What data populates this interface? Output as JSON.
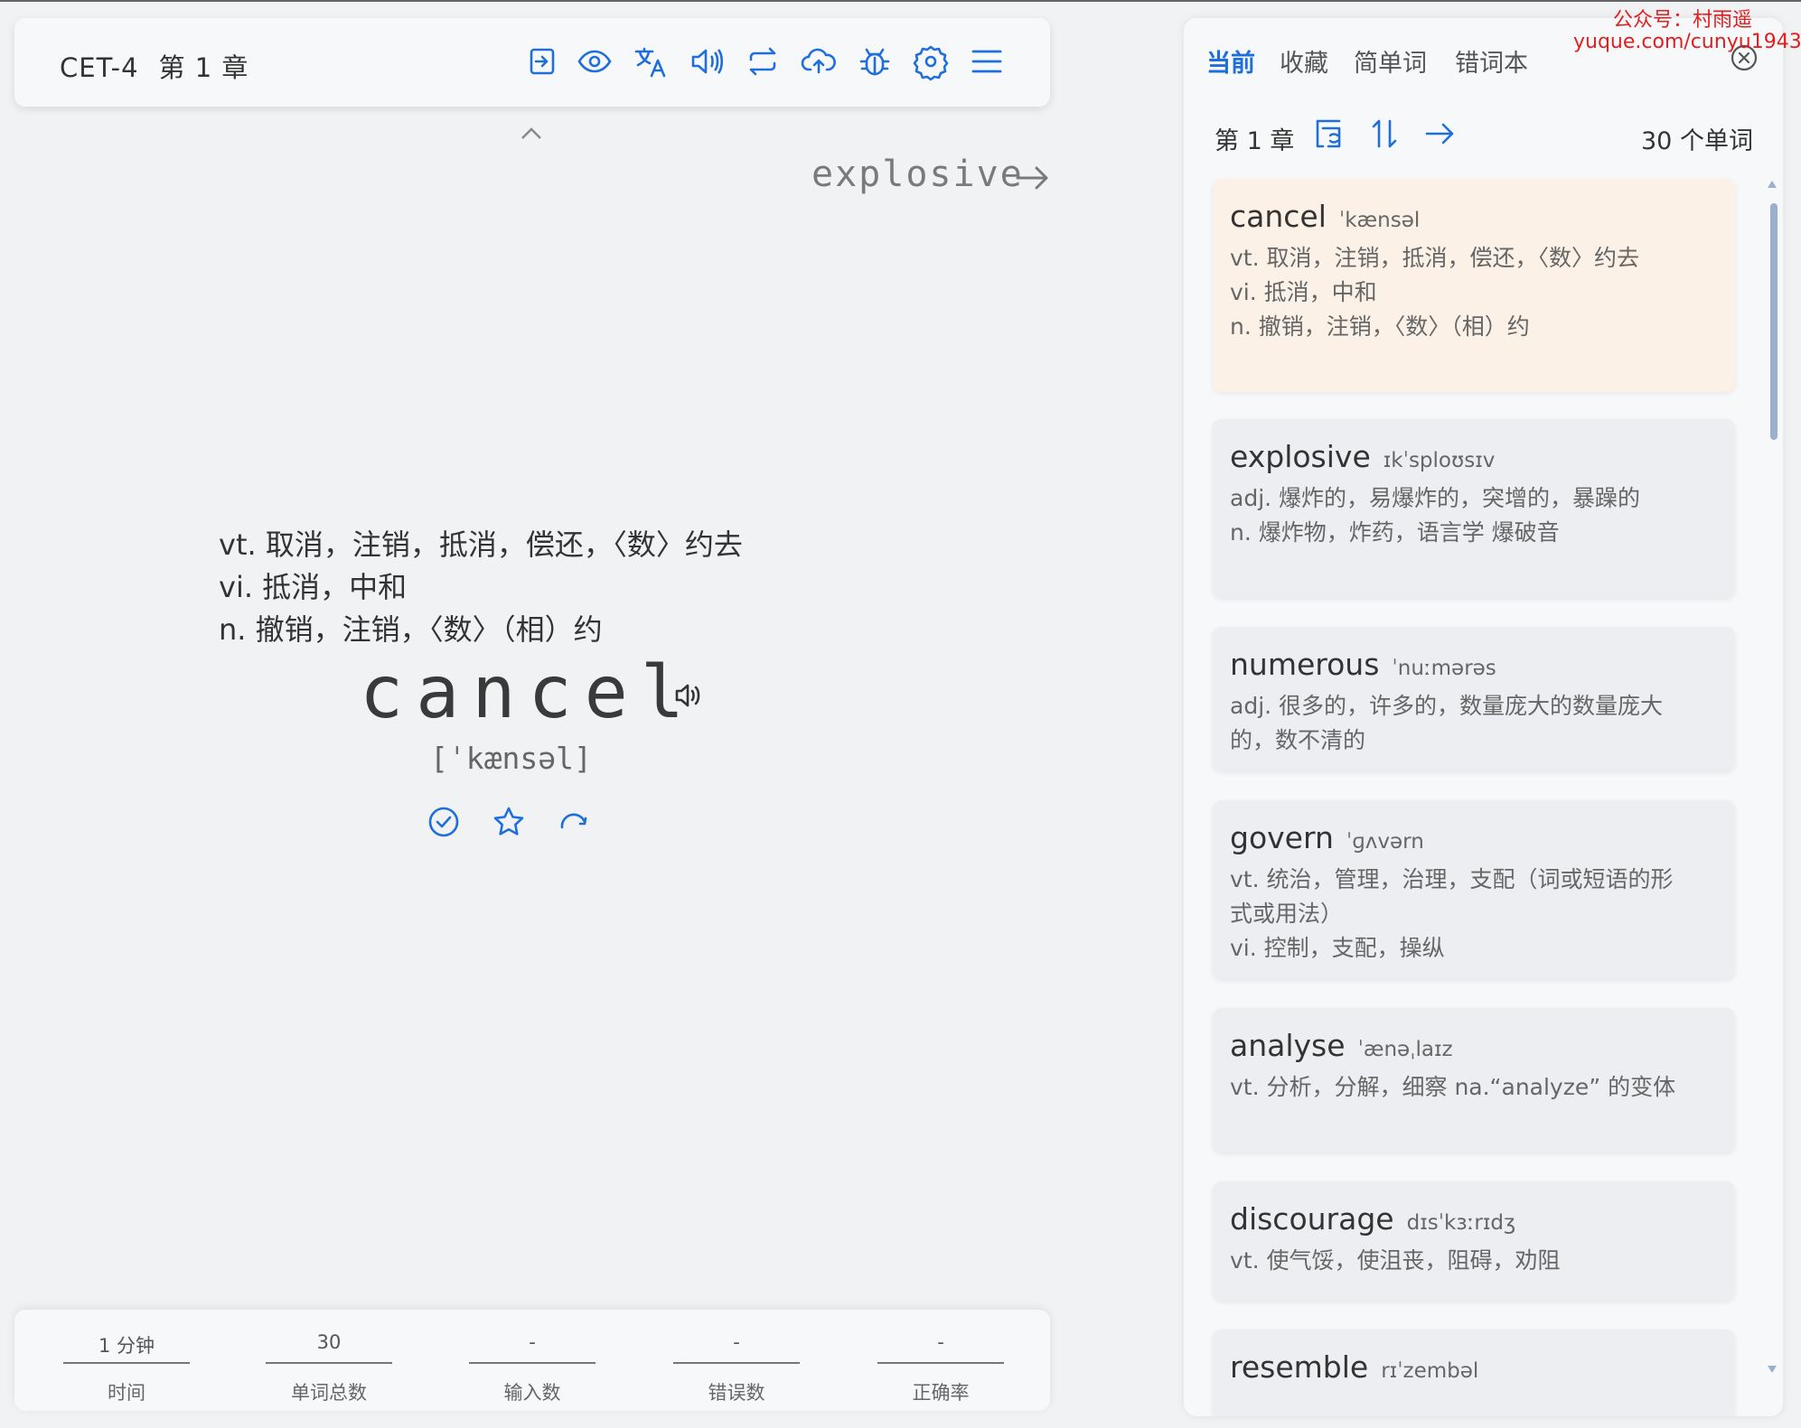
{
  "toolbar": {
    "dict": "CET-4",
    "chapter": "第 1 章",
    "icons": [
      "import-icon",
      "eye-icon",
      "translate-icon",
      "sound-icon",
      "loop-icon",
      "upload-cloud-icon",
      "bug-icon",
      "settings-gear-icon",
      "menu-icon"
    ]
  },
  "main": {
    "next_word": "explosive",
    "definitions": [
      "vt. 取消，注销，抵消，偿还，〈数〉约去",
      "vi. 抵消，中和",
      "n. 撤销，注销，〈数〉（相）约"
    ],
    "word": "cancel",
    "phonetic": "[ˈkænsəl]"
  },
  "stats": [
    {
      "value": "1 分钟",
      "label": "时间"
    },
    {
      "value": "30",
      "label": "单词总数"
    },
    {
      "value": "-",
      "label": "输入数"
    },
    {
      "value": "-",
      "label": "错误数"
    },
    {
      "value": "-",
      "label": "正确率"
    }
  ],
  "panel": {
    "tabs": [
      "当前",
      "收藏",
      "简单词",
      "错词本"
    ],
    "chapter": "第 1 章",
    "count": "30 个单词",
    "words": [
      {
        "word": "cancel",
        "phonetic": "ˈkænsəl",
        "trans": [
          "vt. 取消，注销，抵消，偿还，〈数〉约去",
          "vi. 抵消，中和",
          "n. 撤销，注销，〈数〉（相）约"
        ]
      },
      {
        "word": "explosive",
        "phonetic": "ɪkˈsploʊsɪv",
        "trans": [
          "adj. 爆炸的，易爆炸的，突增的，暴躁的",
          "n. 爆炸物，炸药，语言学 爆破音"
        ]
      },
      {
        "word": "numerous",
        "phonetic": "ˈnuːmərəs",
        "trans": [
          "adj. 很多的，许多的，数量庞大的数量庞大的，数不清的"
        ]
      },
      {
        "word": "govern",
        "phonetic": "ˈɡʌvərn",
        "trans": [
          "vt. 统治，管理，治理，支配（词或短语的形式或用法）",
          "vi. 控制，支配，操纵"
        ]
      },
      {
        "word": "analyse",
        "phonetic": "ˈænəˌlaɪz",
        "trans": [
          "vt. 分析，分解，细察 na.“analyze” 的变体"
        ]
      },
      {
        "word": "discourage",
        "phonetic": "dɪsˈkɜːrɪdʒ",
        "trans": [
          "vt. 使气馁，使沮丧，阻碍，劝阻"
        ]
      },
      {
        "word": "resemble",
        "phonetic": "rɪˈzembəl",
        "trans": []
      }
    ]
  },
  "watermark": {
    "line1": "公众号：村雨遥",
    "line2": "yuque.com/cunyu1943"
  },
  "colors": {
    "accent": "#1e6fdc",
    "current_card": "#fbf1e6",
    "card": "#eceef1",
    "watermark": "#e02020"
  }
}
